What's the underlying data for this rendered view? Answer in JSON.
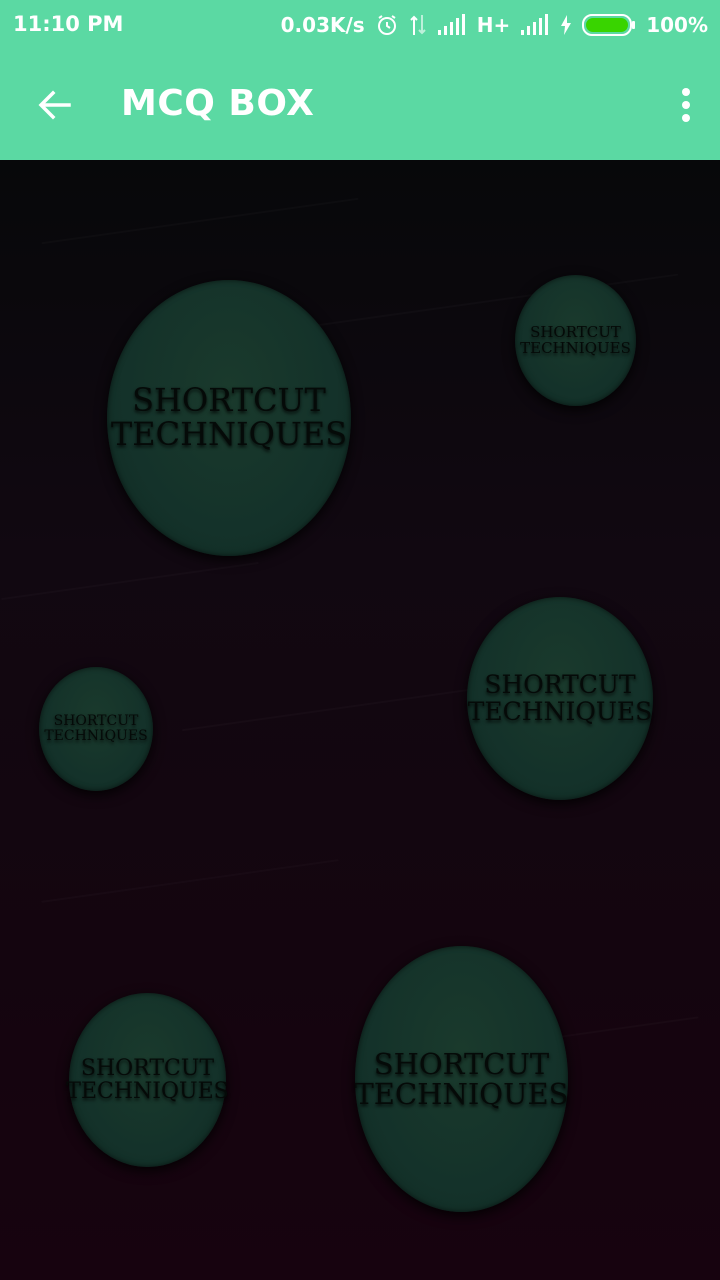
{
  "status_bar": {
    "time": "11:10 PM",
    "speed": "0.03K/s",
    "network": "H+",
    "battery": "100%"
  },
  "app_bar": {
    "title": "MCQ BOX"
  },
  "bubbles": [
    {
      "line1": "SHORTCUT",
      "line2": "TECHNIQUES"
    },
    {
      "line1": "SHORTCUT",
      "line2": "TECHNIQUES"
    },
    {
      "line1": "SHORTCUT",
      "line2": "TECHNIQUES"
    },
    {
      "line1": "SHORTCUT",
      "line2": "TECHNIQUES"
    },
    {
      "line1": "SHORTCUT",
      "line2": "TECHNIQUES"
    },
    {
      "line1": "SHORTCUT",
      "line2": "TECHNIQUES"
    }
  ],
  "colors": {
    "accent": "#5bd9a3",
    "bubble": "#14322a",
    "background": "#120810"
  }
}
